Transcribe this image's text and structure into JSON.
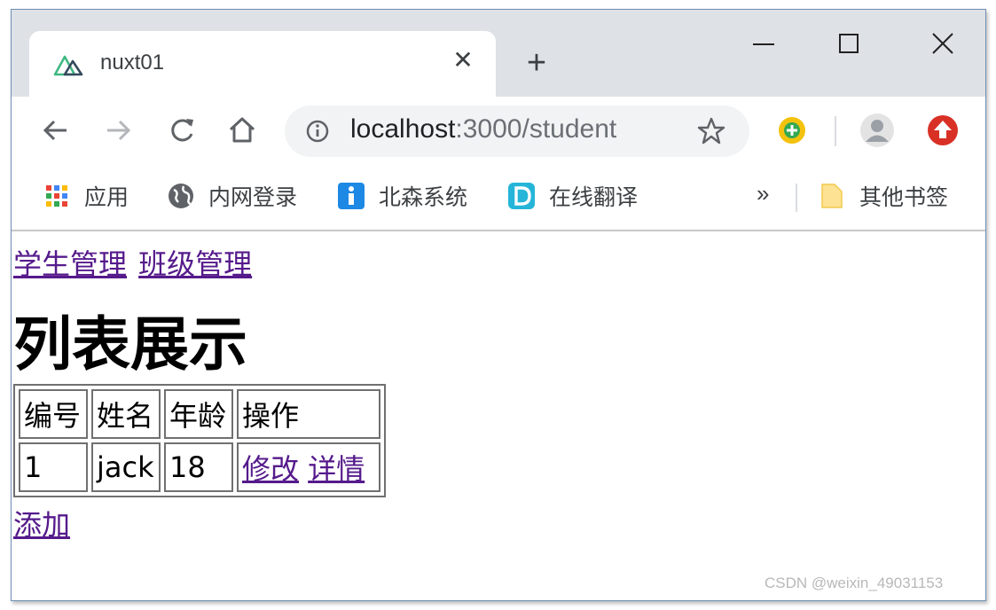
{
  "tab": {
    "title": "nuxt01",
    "favicon": "nuxt-logo-icon"
  },
  "toolbar": {
    "url_host": "localhost",
    "url_path": ":3000/student"
  },
  "bookmarks": {
    "items": [
      {
        "label": "应用",
        "icon": "apps-grid-icon"
      },
      {
        "label": "内网登录",
        "icon": "globe-icon"
      },
      {
        "label": "北森系统",
        "icon": "info-blue-icon"
      },
      {
        "label": "在线翻译",
        "icon": "translate-d-icon"
      }
    ],
    "more": "»",
    "other": "其他书签"
  },
  "page": {
    "nav": [
      "学生管理",
      "班级管理"
    ],
    "heading": "列表展示",
    "table": {
      "headers": [
        "编号",
        "姓名",
        "年龄",
        "操作"
      ],
      "rows": [
        {
          "id": "1",
          "name": "jack",
          "age": "18",
          "actions": [
            "修改",
            "详情"
          ]
        }
      ]
    },
    "add_label": "添加"
  },
  "watermark": "CSDN @weixin_49031153",
  "colors": {
    "tab_strip": "#dee1e6",
    "link_visited": "#551a8b",
    "omnibox": "#f1f3f4"
  }
}
